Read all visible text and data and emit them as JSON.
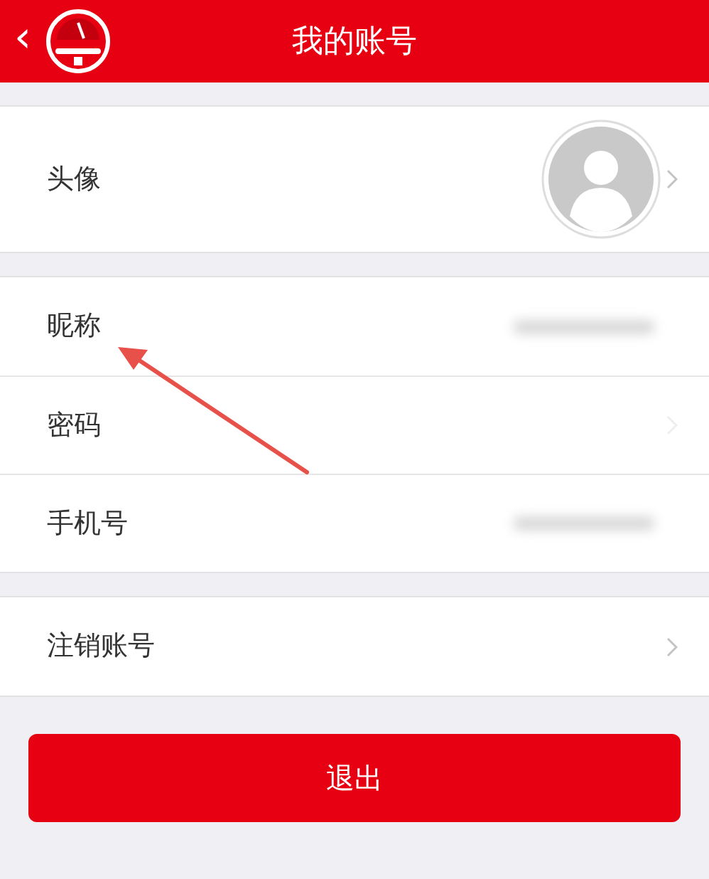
{
  "header": {
    "back": "‹",
    "title": "我的账号"
  },
  "groups": [
    [
      {
        "label": "头像",
        "kind": "avatar"
      }
    ],
    [
      {
        "label": "昵称",
        "kind": "blurred"
      },
      {
        "label": "密码",
        "kind": "faint-chevron"
      },
      {
        "label": "手机号",
        "kind": "blurred"
      }
    ],
    [
      {
        "label": "注销账号",
        "kind": "chevron"
      }
    ]
  ],
  "logout_button": "退出",
  "annotation": {
    "kind": "arrow"
  }
}
